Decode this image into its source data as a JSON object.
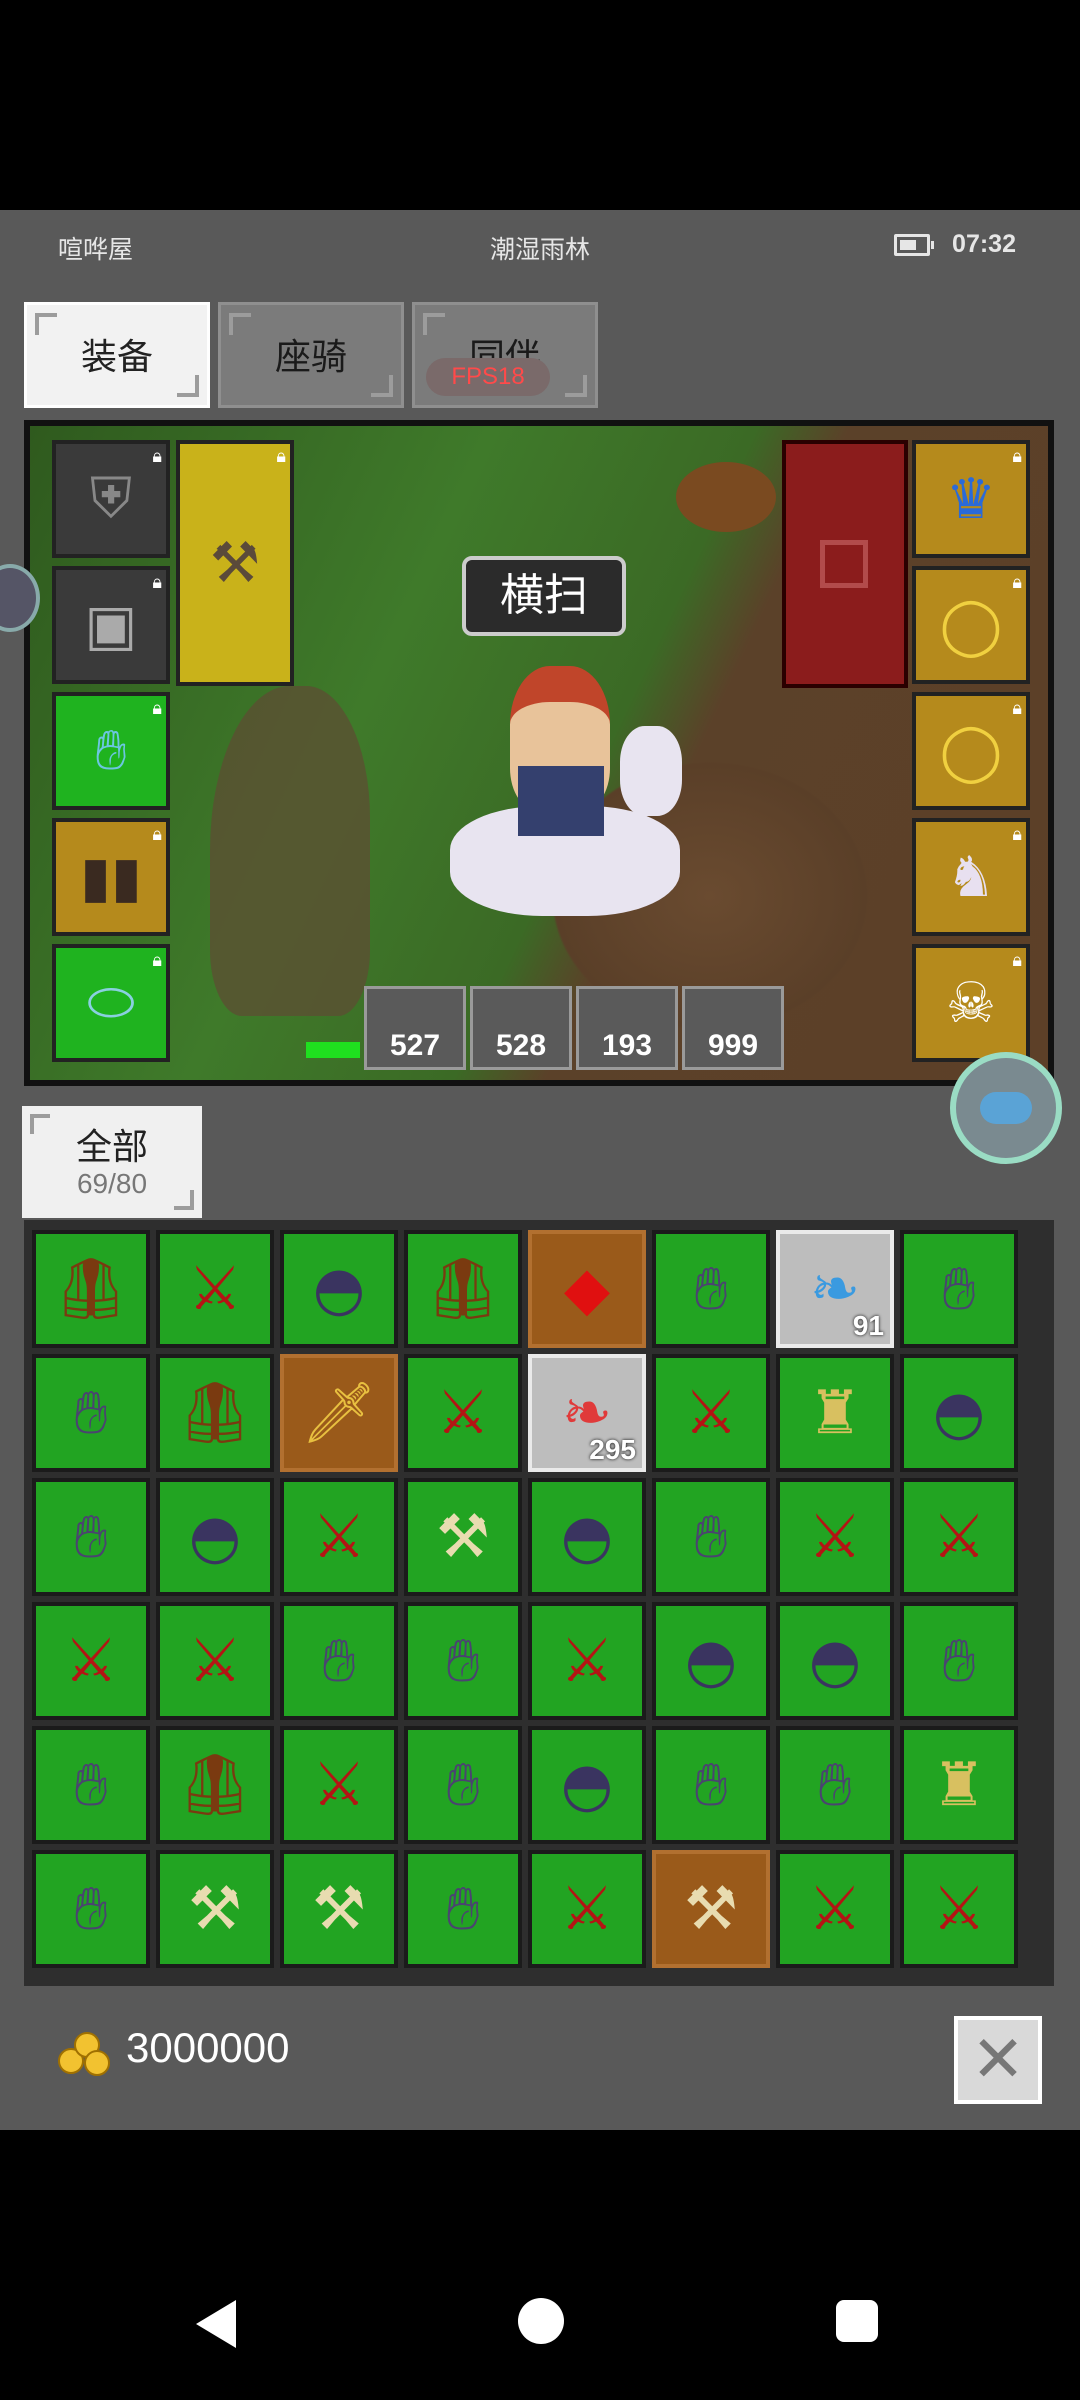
{
  "status": {
    "location": "喧哗屋",
    "map_name": "潮湿雨林",
    "time": "07:32"
  },
  "tabs": [
    {
      "label": "装备",
      "active": true
    },
    {
      "label": "座骑",
      "active": false
    },
    {
      "label": "同伴",
      "active": false
    }
  ],
  "fps": "FPS18",
  "scene": {
    "skill_bubble": "横扫",
    "left_slots": [
      "helmet-armor",
      "chest-armor",
      "gloves",
      "boots",
      "belt"
    ],
    "weapon_slot": "mace",
    "right_slots": [
      "crown",
      "ring",
      "ring",
      "mount-card",
      "companion-card"
    ],
    "potions": [
      {
        "icon": "potion",
        "count": "527"
      },
      {
        "icon": "potion",
        "count": "528"
      },
      {
        "icon": "fish",
        "count": "193"
      },
      {
        "icon": "fish",
        "count": "999"
      }
    ]
  },
  "filter": {
    "label": "全部",
    "count": "69/80"
  },
  "inventory": [
    [
      "armor",
      "sword",
      "helm",
      "armor",
      "gem",
      "glove",
      "wing-blue",
      "glove"
    ],
    [
      "glove",
      "armor",
      "dagger",
      "sword",
      "wing-red",
      "sword",
      "crest",
      "helm"
    ],
    [
      "glove",
      "helm",
      "sword",
      "axe",
      "helm",
      "glove",
      "sword",
      "sword"
    ],
    [
      "sword",
      "sword",
      "glove",
      "glove",
      "sword",
      "helm",
      "helm",
      "glove"
    ],
    [
      "glove",
      "armor",
      "sword",
      "glove",
      "helm",
      "glove",
      "glove",
      "crest"
    ],
    [
      "glove",
      "axe",
      "axe",
      "glove",
      "sword",
      "axe",
      "sword",
      "sword"
    ]
  ],
  "inventory_special": {
    "wing_blue_qty": "91",
    "wing_red_qty": "295"
  },
  "gold": "3000000",
  "colors": {
    "slot_green": "#22a422",
    "slot_brown": "#9a5a1a",
    "accent_red": "#ff4a4a"
  }
}
